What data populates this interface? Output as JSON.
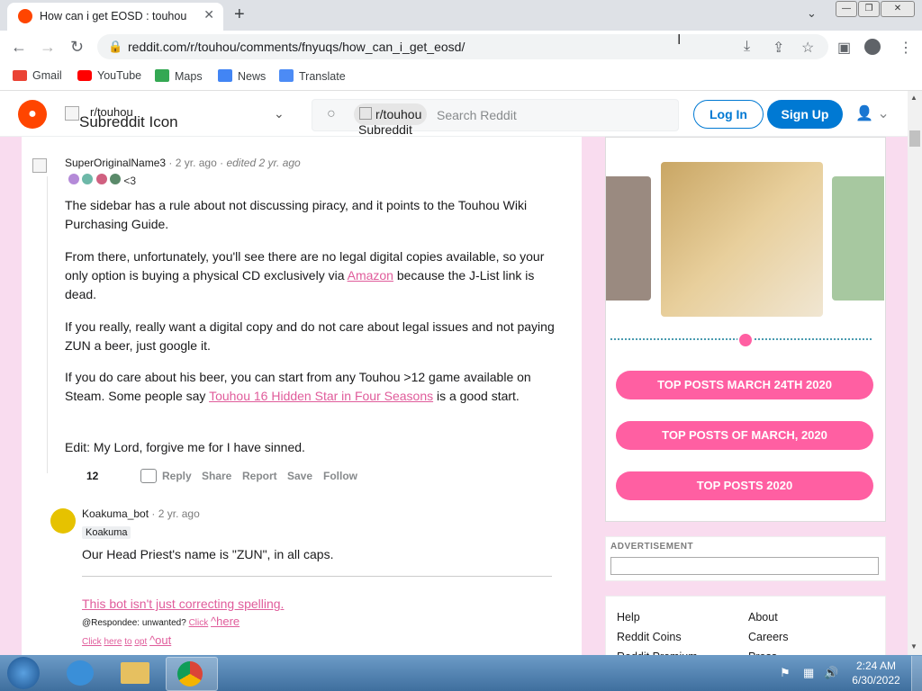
{
  "browser": {
    "tab_title": "How can i get EOSD : touhou",
    "url": "reddit.com/r/touhou/comments/fnyuqs/how_can_i_get_eosd/",
    "bookmarks": [
      "Gmail",
      "YouTube",
      "Maps",
      "News",
      "Translate"
    ]
  },
  "header": {
    "sub_icon_alt": "r/touhou",
    "sub_icon_alt2": "Subreddit Icon",
    "search_chip": "r/touhou",
    "search_chip_overflow": "Subreddit\nIcon",
    "search_placeholder": "Search Reddit",
    "login": "Log In",
    "signup": "Sign Up"
  },
  "comment1": {
    "author": "SuperOriginalName3",
    "age": "2 yr. ago",
    "edited": "edited 2 yr. ago",
    "flair_text": "<3",
    "p1": "The sidebar has a rule about not discussing piracy, and it points to the Touhou Wiki Purchasing Guide.",
    "p2_a": "From there, unfortunately, you'll see there are no legal digital copies available, so your only option is buying a physical CD exclusively via ",
    "p2_link": "Amazon",
    "p2_b": " because the J-List link is dead.",
    "p3": "If you really, really want a digital copy and do not care about legal issues and not paying ZUN a beer, just google it.",
    "p4_a": "If you do care about his beer, you can start from any Touhou >12 game available on Steam. Some people say ",
    "p4_link": "Touhou 16 Hidden Star in Four Seasons",
    "p4_b": " is a good start.",
    "p5": "Edit: My Lord, forgive me for I have sinned.",
    "score": "12",
    "actions": [
      "Reply",
      "Share",
      "Report",
      "Save",
      "Follow"
    ]
  },
  "comment2": {
    "author": "Koakuma_bot",
    "age": "2 yr. ago",
    "flair": "Koakuma",
    "text": "Our Head Priest's name is \"ZUN\", in all caps.",
    "footer_link": "This bot isn't just correcting spelling.",
    "footer_line2_a": "@Respondee: unwanted?",
    "footer_line2_link1": "Click",
    "footer_line2_link2": "^here",
    "footer_line3": [
      "Click",
      "here",
      "to",
      "opt",
      "^out"
    ]
  },
  "sidebar": {
    "buttons": [
      "TOP POSTS MARCH 24TH 2020",
      "TOP POSTS OF MARCH, 2020",
      "TOP POSTS 2020"
    ],
    "ad_label": "ADVERTISEMENT",
    "footer_links_left": [
      "Help",
      "Reddit Coins",
      "Reddit Premium"
    ],
    "footer_links_right": [
      "About",
      "Careers",
      "Press"
    ]
  },
  "taskbar": {
    "time": "2:24 AM",
    "date": "6/30/2022"
  }
}
